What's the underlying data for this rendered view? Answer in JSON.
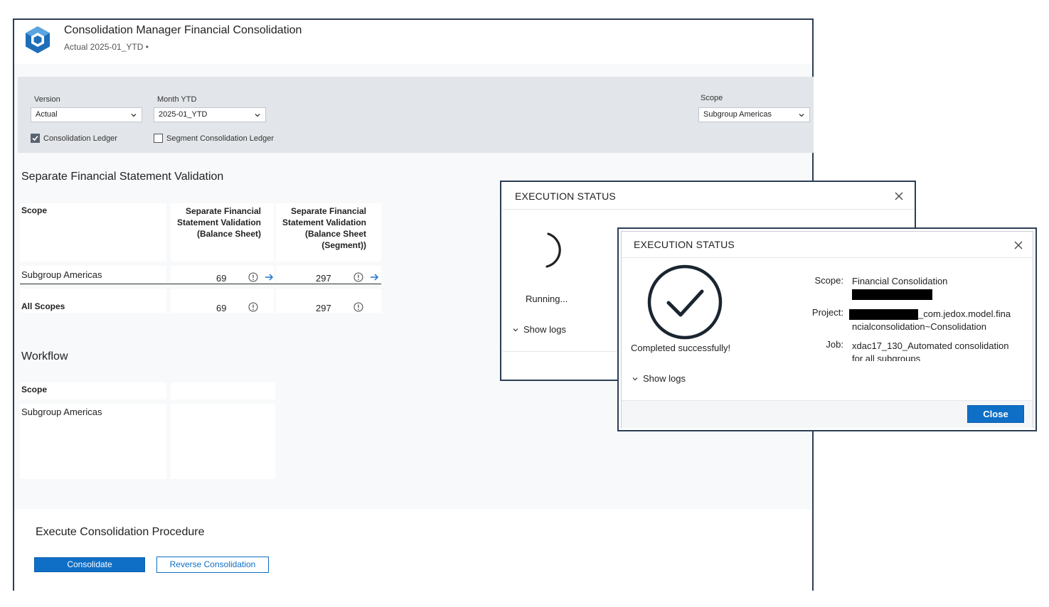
{
  "header": {
    "title": "Consolidation Manager Financial Consolidation",
    "subtitle": "Actual 2025-01_YTD •"
  },
  "filters": {
    "version_label": "Version",
    "version_value": "Actual",
    "month_label": "Month YTD",
    "month_value": "2025-01_YTD",
    "scope_label": "Scope",
    "scope_value": "Subgroup Americas",
    "consolidation_ledger": {
      "label": "Consolidation Ledger",
      "checked": true
    },
    "segment_ledger": {
      "label": "Segment Consolidation Ledger",
      "checked": false
    }
  },
  "validation": {
    "title": "Separate Financial Statement Validation",
    "columns": [
      "Scope",
      "Separate Financial Statement Validation (Balance Sheet)",
      "Separate Financial Statement Validation (Balance Sheet (Segment))"
    ],
    "rows": [
      {
        "scope": "Subgroup Americas",
        "bs": "69",
        "bs_segment": "297"
      },
      {
        "scope": "All Scopes",
        "bs": "69",
        "bs_segment": "297"
      }
    ]
  },
  "workflow": {
    "title": "Workflow",
    "scope_header": "Scope",
    "rows": [
      "Subgroup Americas"
    ]
  },
  "execute": {
    "title": "Execute Consolidation Procedure",
    "consolidate_label": "Consolidate",
    "reverse_label": "Reverse Consolidation"
  },
  "dialog_running": {
    "title": "EXECUTION STATUS",
    "status": "Running...",
    "show_logs": "Show logs"
  },
  "dialog_done": {
    "title": "EXECUTION STATUS",
    "status": "Completed successfully!",
    "show_logs": "Show logs",
    "scope_key": "Scope:",
    "scope_value": "Financial Consolidation",
    "project_key": "Project:",
    "project_value_1": "_com.jedox.model.fina",
    "project_value_2": "ncialconsolidation~Consolidation",
    "job_key": "Job:",
    "job_value_1": "xdac17_130_Automated consolidation",
    "job_value_2": "for all subgroups",
    "close_label": "Close"
  },
  "colors": {
    "primary": "#0f6fc6",
    "filter_bar": "#e2e5e9",
    "frame": "#2c3e55",
    "logo": "#1f6fb8"
  },
  "icons": [
    "app-logo-icon",
    "chevron-down-icon",
    "checkmark-icon",
    "info-icon",
    "arrow-right-icon",
    "close-icon",
    "spinner-icon",
    "success-check-icon"
  ]
}
